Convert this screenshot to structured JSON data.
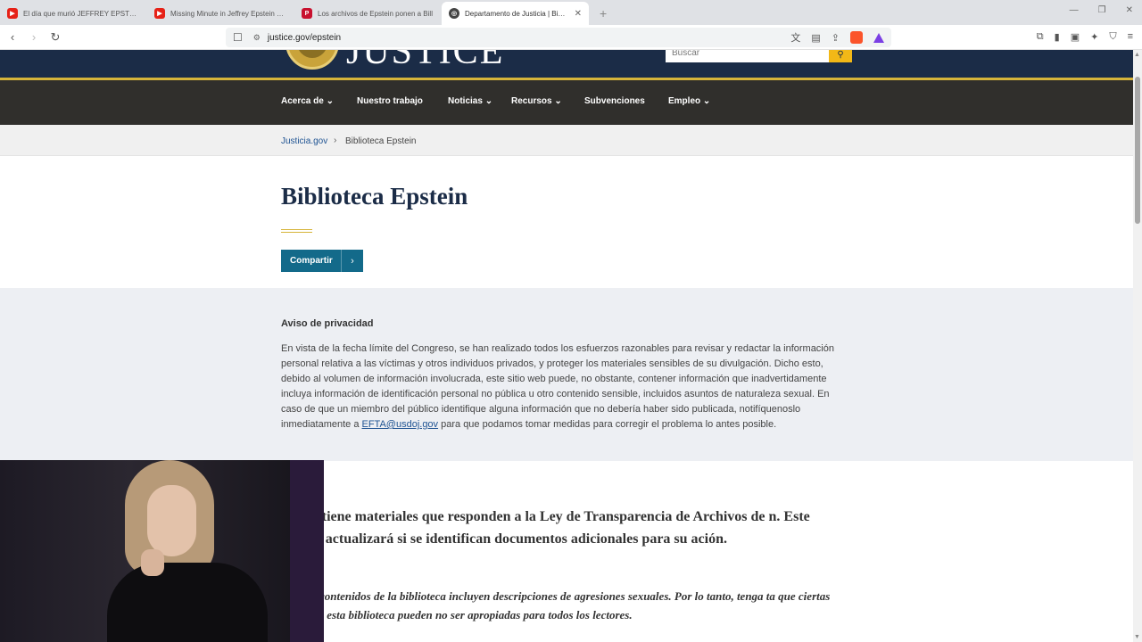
{
  "browser": {
    "tabs": [
      {
        "label": "El día que murió JEFFREY EPSTEIN - Y",
        "favicon": "youtube-icon",
        "color": "#e62117"
      },
      {
        "label": "Missing Minute in Jeffrey Epstein Jail",
        "favicon": "youtube-icon",
        "color": "#e62117"
      },
      {
        "label": "Los archivos de Epstein ponen a Bill",
        "favicon": "p-icon",
        "color": "#c8102e"
      },
      {
        "label": "Departamento de Justicia | Biblio",
        "favicon": "doj-seal-icon",
        "color": "#444444"
      }
    ],
    "url": "justice.gov/epstein",
    "brave_badge": "2"
  },
  "header": {
    "wordmark": "JUSTICE",
    "search_placeholder": "Buscar"
  },
  "nav": {
    "items": [
      {
        "label": "Acerca de",
        "has_dropdown": true
      },
      {
        "label": "Nuestro trabajo",
        "has_dropdown": false
      },
      {
        "label": "Noticias",
        "has_dropdown": true
      },
      {
        "label": "Recursos",
        "has_dropdown": true
      },
      {
        "label": "Subvenciones",
        "has_dropdown": false
      },
      {
        "label": "Empleo",
        "has_dropdown": true
      }
    ]
  },
  "breadcrumb": {
    "home": "Justicia.gov",
    "current": "Biblioteca Epstein"
  },
  "page": {
    "title": "Biblioteca Epstein",
    "share_label": "Compartir"
  },
  "privacy": {
    "heading": "Aviso de privacidad",
    "body_before": "En vista de la fecha límite del Congreso, se han realizado todos los esfuerzos razonables para revisar y redactar la información personal relativa a las víctimas y otros individuos privados, y proteger los materiales sensibles de su divulgación.  Dicho esto, debido al volumen de información involucrada, este sitio web puede, no obstante, contener información que inadvertidamente incluya información de identificación personal no pública u otro contenido sensible, incluidos asuntos de naturaleza sexual.  En caso de que un miembro del público identifique alguna información que no debería haber sido publicada, notifíquenoslo inmediatamente a ",
    "email": "EFTA@usdoj.gov",
    "body_after": " para que podamos tomar medidas para corregir el problema lo antes posible."
  },
  "content": {
    "intro": "tio contiene materiales que responden a la Ley de Transparencia de Archivos de n. Este sitio se actualizará si se identifican documentos adicionales para su ación.",
    "warning": "e de los contenidos de la biblioteca incluyen descripciones de agresiones sexuales. Por lo tanto, tenga ta que ciertas partes de esta biblioteca pueden no ser apropiadas para todos los lectores."
  },
  "colors": {
    "header_navy": "#1b2c47",
    "gold_accent": "#d6b43a",
    "nav_dark": "#302f2c",
    "share_teal": "#136a8a",
    "link_blue": "#205493"
  }
}
